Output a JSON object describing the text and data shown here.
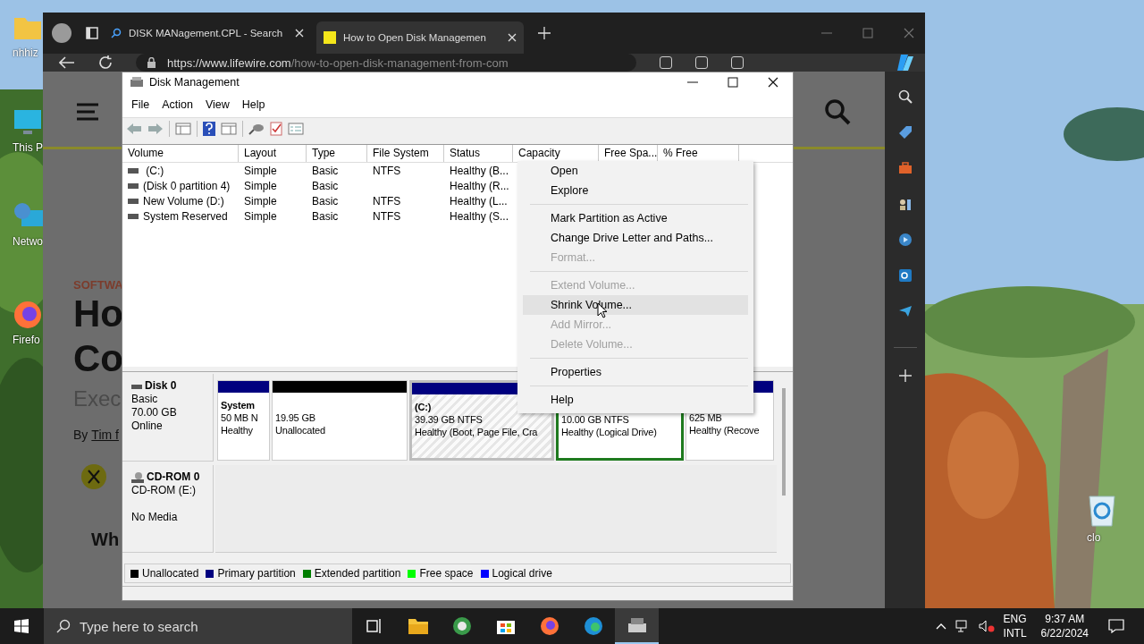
{
  "desktop_icons": [
    {
      "kind": "folder",
      "label": "nhhiz"
    },
    {
      "kind": "computer",
      "label": "This P"
    },
    {
      "kind": "network",
      "label": "Netwo"
    },
    {
      "kind": "firefox",
      "label": "Firefo"
    },
    {
      "kind": "recycle",
      "label": "clo"
    }
  ],
  "browser": {
    "tabs": [
      {
        "label": "DISK MANagement.CPL - Search",
        "kind": "search",
        "selected": false
      },
      {
        "label": "How to Open Disk Managemen",
        "kind": "site",
        "selected": true
      }
    ],
    "address": {
      "host": "https://www.lifewire.com",
      "path": "/how-to-open-disk-management-from-com"
    },
    "page": {
      "category": "SOFTWA",
      "title_lines": [
        "Ho",
        "Co"
      ],
      "subtitle": "Exec",
      "byline": "By",
      "author": "Tim f",
      "heading": "Wh"
    },
    "sidebar": [
      {
        "kind": "search"
      },
      {
        "kind": "tag"
      },
      {
        "kind": "toolbox"
      },
      {
        "kind": "games"
      },
      {
        "kind": "circle"
      },
      {
        "kind": "outlook"
      },
      {
        "kind": "send"
      },
      {
        "kind": "add"
      }
    ]
  },
  "disk_management": {
    "title": "Disk Management",
    "menu": [
      "File",
      "Action",
      "View",
      "Help"
    ],
    "columns": [
      "Volume",
      "Layout",
      "Type",
      "File System",
      "Status",
      "Capacity",
      "Free Spa...",
      "% Free"
    ],
    "rows": [
      {
        "volume": " (C:)",
        "layout": "Simple",
        "type": "Basic",
        "file_system": "NTFS",
        "status": "Healthy (B..."
      },
      {
        "volume": "(Disk 0 partition 4)",
        "layout": "Simple",
        "type": "Basic",
        "status": "Healthy (R..."
      },
      {
        "volume": "New Volume (D:)",
        "layout": "Simple",
        "type": "Basic",
        "file_system": "NTFS",
        "status": "Healthy (L..."
      },
      {
        "volume": "System Reserved",
        "layout": "Simple",
        "type": "Basic",
        "file_system": "NTFS",
        "status": "Healthy (S..."
      }
    ],
    "disks": [
      {
        "kind": "disk",
        "name": "Disk 0",
        "type": "Basic",
        "size": "70.00 GB",
        "status": "Online",
        "partitions": [
          {
            "kind": "primary",
            "name": "System",
            "size": "50 MB N",
            "status": "Healthy",
            "color": "#00007f",
            "selected": false
          },
          {
            "kind": "unallocated",
            "size": "19.95 GB",
            "status": "Unallocated",
            "color": "#000000",
            "selected": false
          },
          {
            "kind": "primary",
            "name": "(C:)",
            "size": "39.39 GB NTFS",
            "status": "Healthy (Boot, Page File, Cra",
            "color": "#00007f",
            "selected": true
          },
          {
            "kind": "logical",
            "size": "10.00 GB NTFS",
            "status": "Healthy (Logical Drive)",
            "selected": false
          },
          {
            "kind": "primary",
            "size": "625 MB",
            "status": "Healthy (Recove",
            "color": "#00007f",
            "selected": false
          }
        ]
      },
      {
        "kind": "cdrom",
        "name": "CD-ROM 0",
        "type": "CD-ROM (E:)",
        "status": "No Media"
      }
    ],
    "legend": [
      {
        "label": "Unallocated",
        "color": "#000000"
      },
      {
        "label": "Primary partition",
        "color": "#00007f"
      },
      {
        "label": "Extended partition",
        "color": "#007f00"
      },
      {
        "label": "Free space",
        "color": "#00ff00"
      },
      {
        "label": "Logical drive",
        "color": "#0000ff"
      }
    ]
  },
  "context_menu": [
    {
      "kind": "item",
      "label": "Open",
      "disabled": false,
      "selected": false
    },
    {
      "kind": "item",
      "label": "Explore",
      "disabled": false,
      "selected": false
    },
    {
      "kind": "separator"
    },
    {
      "kind": "item",
      "label": "Mark Partition as Active",
      "disabled": false,
      "selected": false
    },
    {
      "kind": "item",
      "label": "Change Drive Letter and Paths...",
      "disabled": false,
      "selected": false
    },
    {
      "kind": "item",
      "label": "Format...",
      "disabled": true,
      "selected": false
    },
    {
      "kind": "separator"
    },
    {
      "kind": "item",
      "label": "Extend Volume...",
      "disabled": true,
      "selected": false
    },
    {
      "kind": "item",
      "label": "Shrink Volume...",
      "disabled": false,
      "selected": true
    },
    {
      "kind": "item",
      "label": "Add Mirror...",
      "disabled": true,
      "selected": false
    },
    {
      "kind": "item",
      "label": "Delete Volume...",
      "disabled": true,
      "selected": false
    },
    {
      "kind": "separator"
    },
    {
      "kind": "item",
      "label": "Properties",
      "disabled": false,
      "selected": false
    },
    {
      "kind": "separator"
    },
    {
      "kind": "item",
      "label": "Help",
      "disabled": false,
      "selected": false
    }
  ],
  "taskbar": {
    "search": {
      "placeholder": "Type here to search"
    },
    "apps": [
      {
        "kind": "taskview",
        "selected": false
      },
      {
        "kind": "folder",
        "selected": false
      },
      {
        "kind": "gear",
        "selected": false
      },
      {
        "kind": "store",
        "selected": false
      },
      {
        "kind": "firefox",
        "selected": false
      },
      {
        "kind": "edge",
        "selected": false
      },
      {
        "kind": "disk",
        "selected": true
      }
    ],
    "language": "ENG",
    "layout": "INTL",
    "time": "9:37 AM",
    "date": "6/22/2024"
  }
}
